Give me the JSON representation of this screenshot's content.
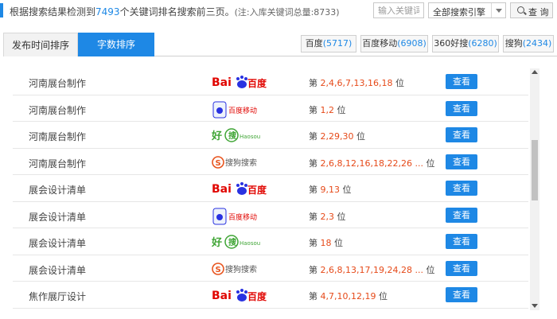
{
  "header": {
    "summary_prefix": "根据搜索结果检测到",
    "keyword_count": "7493",
    "summary_suffix": "个关键词排名搜索前三页。",
    "summary_note": "(注:入库关键词总量:8733)",
    "keyword_placeholder": "输入关键词",
    "engine_select_value": "全部搜索引擎",
    "search_label": "查 询"
  },
  "tabs": [
    {
      "label": "发布时间排序",
      "active": false
    },
    {
      "label": "字数排序",
      "active": true
    }
  ],
  "engine_counts": [
    {
      "name": "百度",
      "count": "(5717)"
    },
    {
      "name": "百度移动",
      "count": "(6908)"
    },
    {
      "name": "360好搜",
      "count": "(6280)"
    },
    {
      "name": "搜狗",
      "count": "(2434)"
    }
  ],
  "rank_prefix": "第",
  "rank_suffix": "位",
  "view_label": "查看",
  "logos": {
    "baidu": {
      "text": "百度",
      "prefix": "Bai",
      "color": "#2932e1",
      "red": "#e10602"
    },
    "baidu_mobile": {
      "text": "百度移动"
    },
    "haosou": {
      "text": "好",
      "sub": "Haosou",
      "color": "#3fa535"
    },
    "sogou": {
      "text": "搜狗搜索",
      "color": "#e8541e"
    }
  },
  "rows": [
    {
      "keyword": "河南展台制作",
      "engine": "baidu",
      "positions": "2,4,6,7,13,16,18"
    },
    {
      "keyword": "河南展台制作",
      "engine": "baidu_mobile",
      "positions": "1,2"
    },
    {
      "keyword": "河南展台制作",
      "engine": "haosou",
      "positions": "2,29,30"
    },
    {
      "keyword": "河南展台制作",
      "engine": "sogou",
      "positions": "2,6,8,12,16,18,22,26 ..."
    },
    {
      "keyword": "展会设计清单",
      "engine": "baidu",
      "positions": "9,13"
    },
    {
      "keyword": "展会设计清单",
      "engine": "baidu_mobile",
      "positions": "2,3"
    },
    {
      "keyword": "展会设计清单",
      "engine": "haosou",
      "positions": "18"
    },
    {
      "keyword": "展会设计清单",
      "engine": "sogou",
      "positions": "2,6,8,13,17,19,24,28 ..."
    },
    {
      "keyword": "焦作展厅设计",
      "engine": "baidu",
      "positions": "4,7,10,12,19"
    }
  ]
}
